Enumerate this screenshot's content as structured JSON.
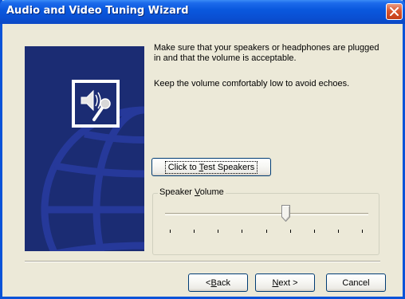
{
  "window": {
    "title": "Audio and Video Tuning Wizard"
  },
  "content": {
    "line1": "Make sure that your speakers or headphones are plugged in and that the volume is acceptable.",
    "line2": "Keep the volume comfortably low to avoid echoes."
  },
  "test_button": {
    "before": "Click to ",
    "accel": "T",
    "after": "est Speakers"
  },
  "volume_group": {
    "label_before": "Speaker ",
    "label_accel": "V",
    "label_after": "olume",
    "level": 0.6
  },
  "nav": {
    "back": {
      "before": "< ",
      "accel": "B",
      "after": "ack"
    },
    "next": {
      "before": "",
      "accel": "N",
      "after": "ext >"
    },
    "cancel": "Cancel"
  },
  "colors": {
    "titlebar": "#0A58DE",
    "panel": "#1B2C73",
    "face": "#ECE9D8",
    "close": "#D9562F"
  },
  "icons": {
    "close": "close-icon",
    "panel": "speaker-microphone-icon"
  }
}
